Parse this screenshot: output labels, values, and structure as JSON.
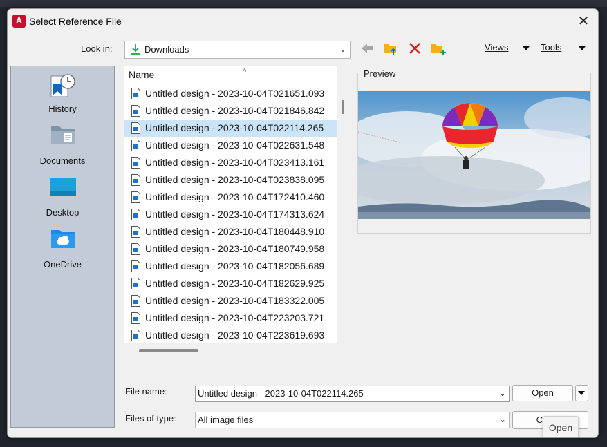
{
  "window": {
    "title": "Select Reference File",
    "app_icon_letter": "A"
  },
  "lookin": {
    "label": "Look in:",
    "value": "Downloads"
  },
  "toolbar": {
    "views_label": "Views",
    "tools_label": "Tools"
  },
  "places": [
    {
      "label": "History",
      "icon": "history-icon"
    },
    {
      "label": "Documents",
      "icon": "documents-icon"
    },
    {
      "label": "Desktop",
      "icon": "desktop-icon"
    },
    {
      "label": "OneDrive",
      "icon": "onedrive-icon"
    }
  ],
  "filelist": {
    "column_header": "Name",
    "files": [
      "Untitled design - 2023-10-04T021651.093",
      "Untitled design - 2023-10-04T021846.842",
      "Untitled design - 2023-10-04T022114.265",
      "Untitled design - 2023-10-04T022631.548",
      "Untitled design - 2023-10-04T023413.161",
      "Untitled design - 2023-10-04T023838.095",
      "Untitled design - 2023-10-04T172410.460",
      "Untitled design - 2023-10-04T174313.624",
      "Untitled design - 2023-10-04T180448.910",
      "Untitled design - 2023-10-04T180749.958",
      "Untitled design - 2023-10-04T182056.689",
      "Untitled design - 2023-10-04T182629.925",
      "Untitled design - 2023-10-04T183322.005",
      "Untitled design - 2023-10-04T223203.721",
      "Untitled design - 2023-10-04T223619.693"
    ],
    "selected_index": 2
  },
  "preview": {
    "label": "Preview"
  },
  "filename": {
    "label": "File name:",
    "value": "Untitled design - 2023-10-04T022114.265"
  },
  "filetype": {
    "label": "Files of type:",
    "value": "All image files"
  },
  "buttons": {
    "open": "Open",
    "cancel": "Cancel"
  },
  "tooltip": {
    "text": "Open"
  },
  "colors": {
    "accent": "#0078d4",
    "selection": "#cce4f7",
    "delete": "#e02020",
    "folder": "#f2b01e",
    "app": "#c8102e"
  }
}
